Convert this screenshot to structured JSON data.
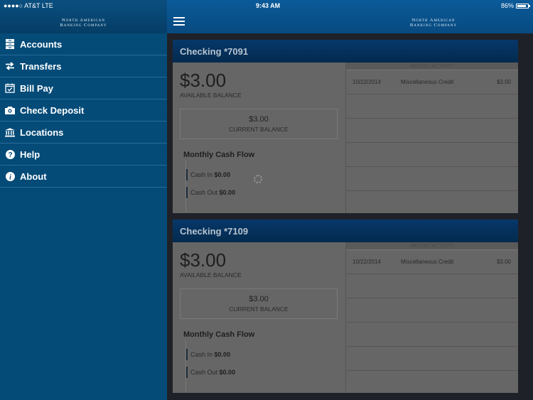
{
  "status_bar": {
    "carrier": "●●●●○ AT&T  LTE",
    "time": "9:43 AM",
    "battery": "86%",
    "battery_level": 0.86
  },
  "brand": {
    "line1": "North American",
    "line2": "Banking Company"
  },
  "sidebar": {
    "items": [
      {
        "label": "Accounts",
        "icon": "accounts-icon"
      },
      {
        "label": "Transfers",
        "icon": "transfers-icon"
      },
      {
        "label": "Bill Pay",
        "icon": "calendar-check-icon"
      },
      {
        "label": "Check Deposit",
        "icon": "camera-icon"
      },
      {
        "label": "Locations",
        "icon": "bank-icon"
      },
      {
        "label": "Help",
        "icon": "help-icon"
      },
      {
        "label": "About",
        "icon": "info-icon"
      }
    ]
  },
  "accounts": [
    {
      "title": "Checking *7091",
      "available_balance": "$3.00",
      "available_label": "AVAILABLE BALANCE",
      "current_balance": "$3.00",
      "current_label": "CURRENT BALANCE",
      "cash_flow_title": "Monthly Cash Flow",
      "cash_in_label": "Cash In",
      "cash_in": "$0.00",
      "cash_out_label": "Cash Out",
      "cash_out": "$0.00",
      "recent_activity_label": "RECENT ACTIVITY",
      "activity": [
        {
          "date": "10/22/2014",
          "description": "Miscellaneous Credit",
          "amount": "$3.00"
        }
      ]
    },
    {
      "title": "Checking *7109",
      "available_balance": "$3.00",
      "available_label": "AVAILABLE BALANCE",
      "current_balance": "$3.00",
      "current_label": "CURRENT BALANCE",
      "cash_flow_title": "Monthly Cash Flow",
      "cash_in_label": "Cash In",
      "cash_in": "$0.00",
      "cash_out_label": "Cash Out",
      "cash_out": "$0.00",
      "recent_activity_label": "RECENT ACTIVITY",
      "activity": [
        {
          "date": "10/22/2014",
          "description": "Miscellaneous Credit",
          "amount": "$3.00"
        }
      ]
    }
  ]
}
